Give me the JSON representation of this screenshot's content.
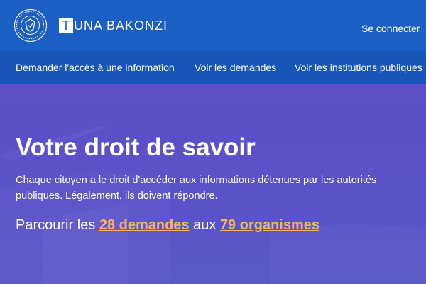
{
  "header": {
    "logo_icon": "government-seal-icon",
    "brand_initial": "T",
    "brand_rest": "UNA BAKONZI",
    "login_label": "Se connecter"
  },
  "nav": {
    "items": [
      {
        "label": "Demander l'accès à une information"
      },
      {
        "label": "Voir les demandes"
      },
      {
        "label": "Voir les institutions publiques"
      }
    ]
  },
  "hero": {
    "title": "Votre droit de savoir",
    "description": "Chaque citoyen a le droit d'accéder aux informations détenues par les autorités publiques. Légalement, ils doivent répondre.",
    "stats_prefix": "Parcourir les",
    "requests_link": "28 demandes",
    "stats_middle": "aux",
    "organisms_link": "79 organismes"
  },
  "colors": {
    "header_bg": "#1c5fc4",
    "nav_bg": "#1857b8",
    "hero_bg": "#5a4fc4",
    "accent": "#f5b35a",
    "text": "#ffffff"
  }
}
